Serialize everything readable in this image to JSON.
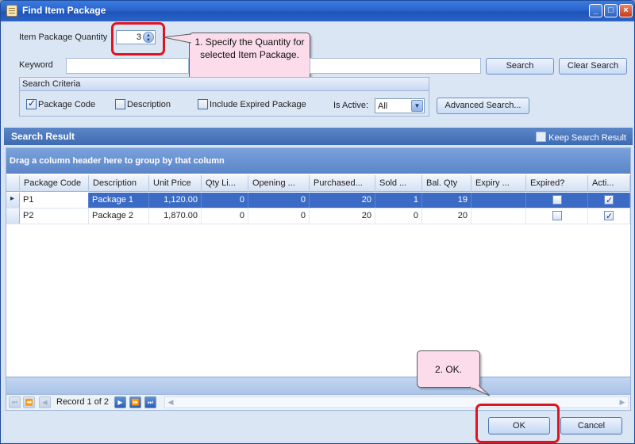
{
  "window": {
    "title": "Find Item Package",
    "controls": {
      "minimize": "_",
      "maximize": "□",
      "close": "×"
    }
  },
  "form": {
    "quantity_label": "Item Package Quantity",
    "quantity_value": "3",
    "keyword_label": "Keyword",
    "keyword_value": "",
    "search_button": "Search",
    "clear_search_button": "Clear Search",
    "search_criteria_label": "Search Criteria",
    "criteria": [
      {
        "label": "Package Code",
        "checked": true
      },
      {
        "label": "Description",
        "checked": false
      },
      {
        "label": "Include Expired Package",
        "checked": false
      }
    ],
    "is_active_label": "Is Active:",
    "is_active_value": "All",
    "advanced_search_button": "Advanced Search..."
  },
  "callouts": {
    "step1": "1. Specify the Quantity for selected Item Package.",
    "step2": "2. OK."
  },
  "results": {
    "title": "Search Result",
    "keep_label": "Keep Search Result",
    "group_hint": "Drag a column header here to group by that column",
    "columns": [
      "Package Code",
      "Description",
      "Unit Price",
      "Qty Li...",
      "Opening ...",
      "Purchased...",
      "Sold ...",
      "Bal. Qty",
      "Expiry ...",
      "Expired?",
      "Acti..."
    ],
    "rows": [
      {
        "code": "P1",
        "description": "Package 1",
        "unit_price": "1,120.00",
        "qty_limit": "0",
        "opening": "0",
        "purchased": "20",
        "sold": "1",
        "bal_qty": "19",
        "expiry": "",
        "expired": false,
        "active": true
      },
      {
        "code": "P2",
        "description": "Package 2",
        "unit_price": "1,870.00",
        "qty_limit": "0",
        "opening": "0",
        "purchased": "20",
        "sold": "0",
        "bal_qty": "20",
        "expiry": "",
        "expired": false,
        "active": true
      }
    ]
  },
  "navigator": {
    "record_text": "Record 1 of 2"
  },
  "footer": {
    "ok_button": "OK",
    "cancel_button": "Cancel"
  },
  "colors": {
    "title_bar": "#2a64cc",
    "selected_row": "#3b6bc4",
    "highlight": "#e0141e",
    "callout_bg": "#fcdcea"
  }
}
